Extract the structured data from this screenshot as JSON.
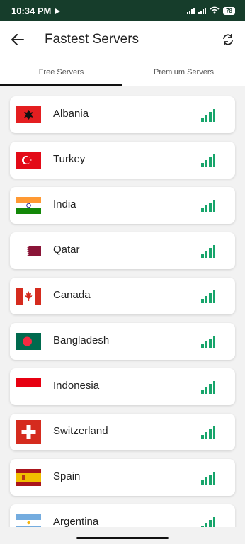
{
  "status_bar": {
    "time": "10:34 PM",
    "battery": "78"
  },
  "header": {
    "title": "Fastest Servers"
  },
  "tabs": [
    {
      "label": "Free Servers",
      "active": true
    },
    {
      "label": "Premium Servers",
      "active": false
    }
  ],
  "servers": [
    {
      "country": "Albania",
      "flag": "albania-flag-icon"
    },
    {
      "country": "Turkey",
      "flag": "turkey-flag-icon"
    },
    {
      "country": "India",
      "flag": "india-flag-icon"
    },
    {
      "country": "Qatar",
      "flag": "qatar-flag-icon"
    },
    {
      "country": "Canada",
      "flag": "canada-flag-icon"
    },
    {
      "country": "Bangladesh",
      "flag": "bangladesh-flag-icon"
    },
    {
      "country": "Indonesia",
      "flag": "indonesia-flag-icon"
    },
    {
      "country": "Switzerland",
      "flag": "switzerland-flag-icon"
    },
    {
      "country": "Spain",
      "flag": "spain-flag-icon"
    },
    {
      "country": "Argentina",
      "flag": "argentina-flag-icon"
    }
  ],
  "colors": {
    "status_bar": "#163d2b",
    "signal": "#17a56b",
    "tab_indicator": "#111111"
  }
}
